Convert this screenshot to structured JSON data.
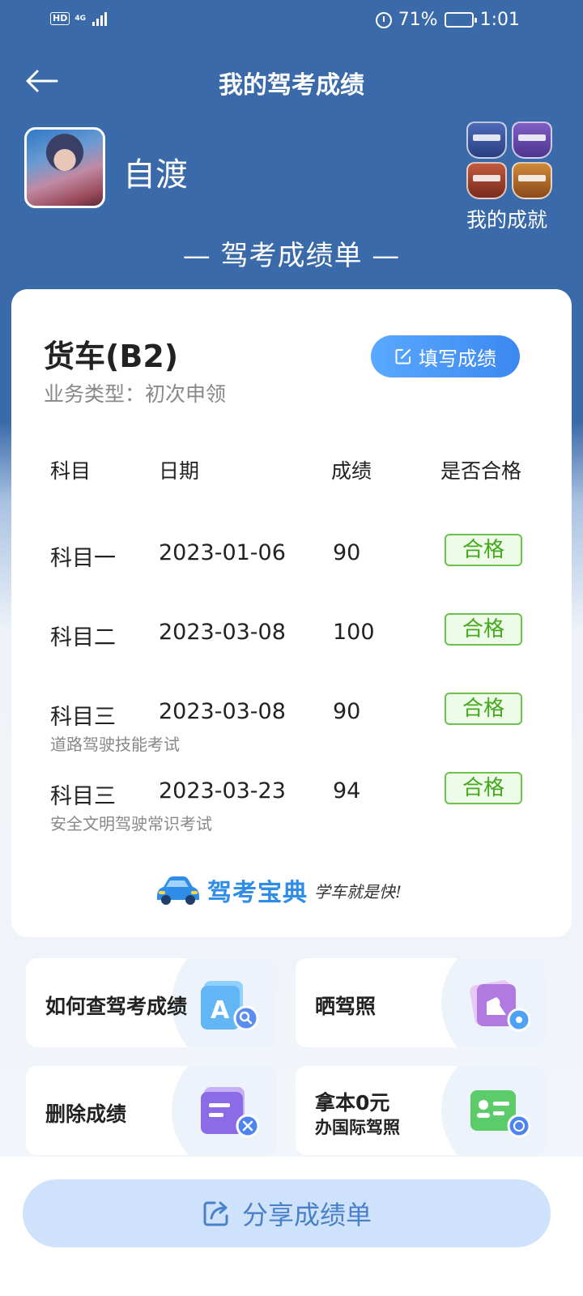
{
  "status_bar": {
    "network": "HD",
    "network_gen": "4G",
    "battery_level": "71%",
    "battery_fraction": 0.71,
    "time": "1:01"
  },
  "header": {
    "title": "我的驾考成绩",
    "back_icon": "arrow-left-icon"
  },
  "profile": {
    "name": "自渡",
    "achievements_label": "我的成就"
  },
  "section_title": "— 驾考成绩单 —",
  "card": {
    "license_type": "货车(B2)",
    "business_type": "业务类型：初次申领",
    "fill_button_label": "填写成绩",
    "columns": [
      "科目",
      "日期",
      "成绩",
      "是否合格"
    ],
    "rows": [
      {
        "subject": "科目一",
        "date": "2023-01-06",
        "score": "90",
        "result": "合格",
        "sub": ""
      },
      {
        "subject": "科目二",
        "date": "2023-03-08",
        "score": "100",
        "result": "合格",
        "sub": ""
      },
      {
        "subject": "科目三",
        "date": "2023-03-08",
        "score": "90",
        "result": "合格",
        "sub": "道路驾驶技能考试"
      },
      {
        "subject": "科目三",
        "date": "2023-03-23",
        "score": "94",
        "result": "合格",
        "sub": "安全文明驾驶常识考试"
      }
    ],
    "brand_name": "驾考宝典",
    "brand_slogan": "学车就是快!"
  },
  "tiles": [
    {
      "line1": "如何查驾考成绩",
      "line2": "",
      "icon": "search-document-icon"
    },
    {
      "line1": "晒驾照",
      "line2": "",
      "icon": "photo-share-icon"
    },
    {
      "line1": "删除成绩",
      "line2": "",
      "icon": "delete-record-icon"
    },
    {
      "line1": "拿本0元",
      "line2": "办国际驾照",
      "icon": "international-license-icon"
    }
  ],
  "share_button_label": "分享成绩单",
  "colors": {
    "header_blue": "#3a6aaa",
    "pass_green": "#46a81e",
    "button_blue": "#3c88f0",
    "share_bg": "#cfe2fb"
  }
}
